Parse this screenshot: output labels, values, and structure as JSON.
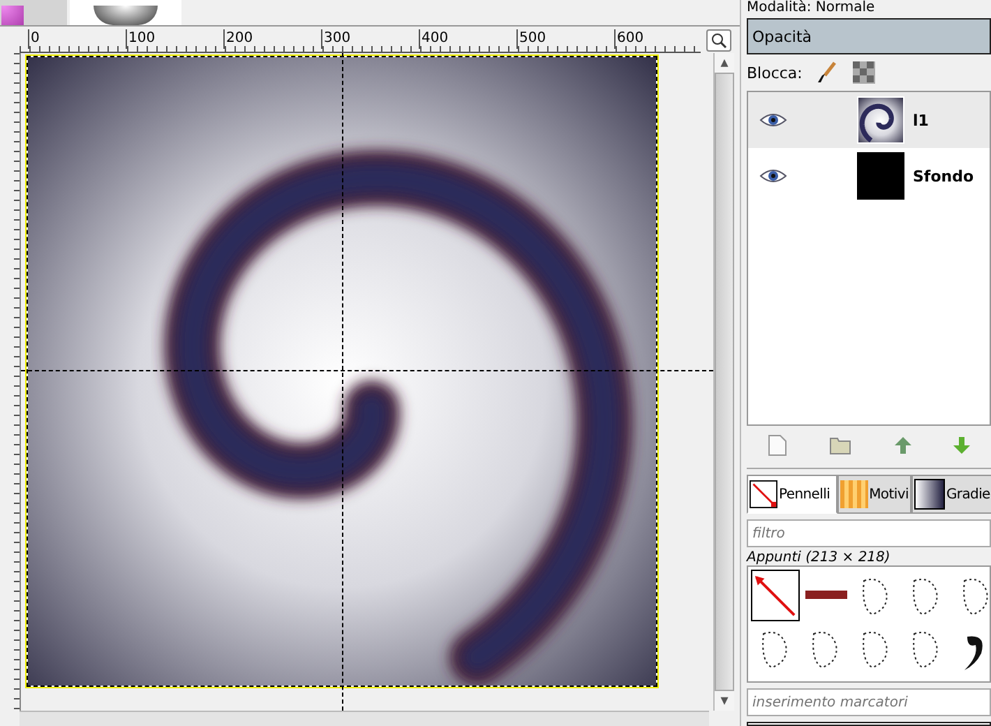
{
  "image_tabs": [
    {
      "selected": false
    },
    {
      "selected": true
    }
  ],
  "ruler": {
    "labels": [
      "0",
      "100",
      "200",
      "300",
      "400",
      "500",
      "600"
    ]
  },
  "scrollbar": {
    "up_arrow": "▴",
    "down_arrow": "▾"
  },
  "layers_panel": {
    "mode_label": "Modalità: Normale",
    "opacity": {
      "label": "Opacità",
      "level": 1
    },
    "lock_label": "Blocca:",
    "layers": [
      {
        "name": "l1",
        "visible": true,
        "selected": true,
        "kind": "spiral"
      },
      {
        "name": "Sfondo",
        "visible": true,
        "selected": false,
        "kind": "black"
      }
    ]
  },
  "brushes_panel": {
    "tabs": [
      {
        "label": "Pennelli",
        "selected": true,
        "kind": "brush"
      },
      {
        "label": "Motivi",
        "selected": false,
        "kind": "pattern"
      },
      {
        "label": "Gradie",
        "selected": false,
        "kind": "gradient"
      }
    ],
    "filter_placeholder": "filtro",
    "brush_name": "Appunti (213 × 218)",
    "tag_placeholder": "inserimento marcatori"
  }
}
